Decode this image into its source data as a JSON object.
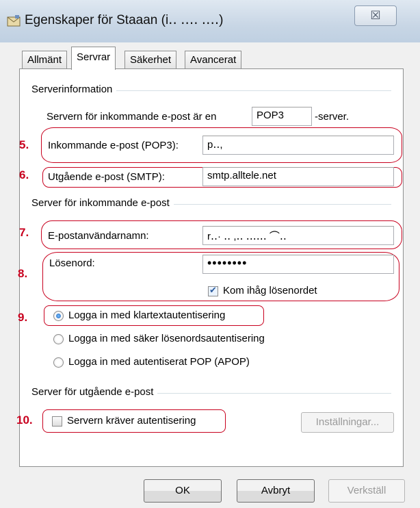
{
  "window": {
    "title": "Egenskaper för Staaan (i‥ ‥‥ ‥‥)",
    "close_glyph": "☒"
  },
  "tabs": [
    "Allmänt",
    "Servrar",
    "Säkerhet",
    "Avancerat"
  ],
  "server_info": {
    "heading": "Serverinformation",
    "incoming_type_prefix": "Servern för inkommande e-post är en",
    "incoming_type_value": "POP3",
    "incoming_type_suffix": "-server.",
    "incoming_label": "Inkommande e-post (POP3):",
    "incoming_value": "p‥,",
    "outgoing_label": "Utgående e-post (SMTP):",
    "outgoing_value": "smtp.alltele.net"
  },
  "incoming_server": {
    "heading": "Server för inkommande e-post",
    "username_label": "E-postanvändarnamn:",
    "username_value": "r‥· ‥ ,‥ ‥‥‥ ⌒‥",
    "password_label": "Lösenord:",
    "password_value": "••••••••",
    "remember_password": "Kom ihåg lösenordet",
    "remember_checked": true,
    "login_options": [
      "Logga in med klartextautentisering",
      "Logga in med säker lösenordsautentisering",
      "Logga in med autentiserat POP (APOP)"
    ],
    "selected_login": 0
  },
  "outgoing_server": {
    "heading": "Server för utgående e-post",
    "requires_auth": "Servern kräver autentisering",
    "requires_auth_checked": false,
    "settings_button": "Inställningar..."
  },
  "annotations": [
    "5.",
    "6.",
    "7.",
    "8.",
    "9.",
    "10."
  ],
  "annotation_color": "#c8001e",
  "buttons": {
    "ok": "OK",
    "cancel": "Avbryt",
    "apply": "Verkställ"
  }
}
